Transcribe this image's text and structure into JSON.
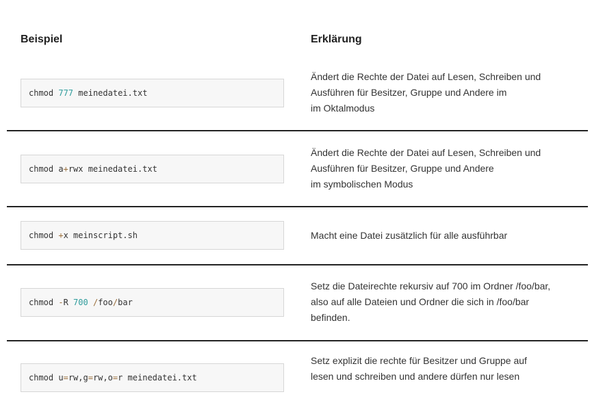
{
  "table": {
    "headers": {
      "example": "Beispiel",
      "explanation": "Erklärung"
    },
    "rows": [
      {
        "code": [
          {
            "t": "chmod ",
            "k": "plain"
          },
          {
            "t": "777",
            "k": "num"
          },
          {
            "t": " meinedatei.txt",
            "k": "plain"
          }
        ],
        "desc": [
          "Ändert die Rechte der Datei auf Lesen, Schreiben und",
          "Ausführen für Besitzer, Gruppe und Andere im",
          "im Oktalmodus"
        ]
      },
      {
        "code": [
          {
            "t": "chmod a",
            "k": "plain"
          },
          {
            "t": "+",
            "k": "op"
          },
          {
            "t": "rwx meinedatei.txt",
            "k": "plain"
          }
        ],
        "desc": [
          "Ändert die Rechte der Datei auf Lesen, Schreiben und",
          "Ausführen für Besitzer, Gruppe und Andere",
          "im symbolischen Modus"
        ]
      },
      {
        "code": [
          {
            "t": "chmod ",
            "k": "plain"
          },
          {
            "t": "+",
            "k": "op"
          },
          {
            "t": "x meinscript.sh",
            "k": "plain"
          }
        ],
        "desc": [
          "Macht eine Datei zusätzlich für alle ausführbar"
        ]
      },
      {
        "code": [
          {
            "t": "chmod ",
            "k": "plain"
          },
          {
            "t": "-",
            "k": "op"
          },
          {
            "t": "R ",
            "k": "plain"
          },
          {
            "t": "700",
            "k": "num"
          },
          {
            "t": " ",
            "k": "plain"
          },
          {
            "t": "/",
            "k": "op"
          },
          {
            "t": "foo",
            "k": "plain"
          },
          {
            "t": "/",
            "k": "op"
          },
          {
            "t": "bar",
            "k": "plain"
          }
        ],
        "desc": [
          "Setz die Dateirechte rekursiv auf 700 im Ordner /foo/bar,",
          "also auf alle Dateien und Ordner die sich in /foo/bar",
          "befinden."
        ]
      },
      {
        "code": [
          {
            "t": "chmod u",
            "k": "plain"
          },
          {
            "t": "=",
            "k": "op"
          },
          {
            "t": "rw,g",
            "k": "plain"
          },
          {
            "t": "=",
            "k": "op"
          },
          {
            "t": "rw,o",
            "k": "plain"
          },
          {
            "t": "=",
            "k": "op"
          },
          {
            "t": "r meinedatei.txt",
            "k": "plain"
          }
        ],
        "desc": [
          "Setz explizit die rechte für Besitzer und Gruppe auf",
          "lesen und schreiben und andere dürfen nur lesen"
        ]
      }
    ]
  }
}
